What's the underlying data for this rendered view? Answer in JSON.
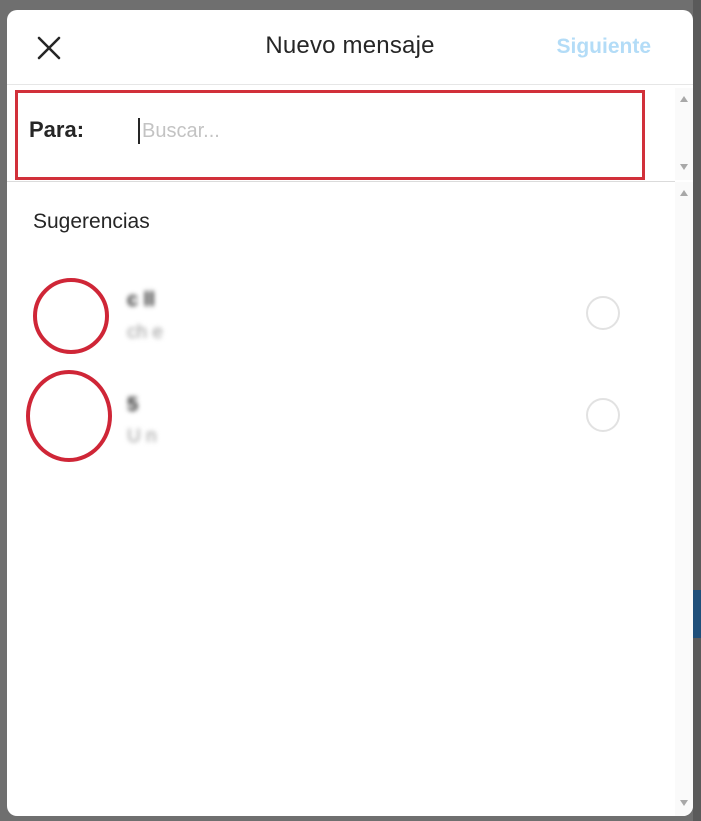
{
  "header": {
    "title": "Nuevo mensaje",
    "next_label": "Siguiente",
    "close_icon": "close-icon"
  },
  "to_field": {
    "label": "Para:",
    "placeholder": "Buscar..."
  },
  "suggestions": {
    "heading": "Sugerencias",
    "items": [
      {
        "name": "c   ll",
        "subtitle": "ch  e"
      },
      {
        "name": "   5",
        "subtitle": "U        n"
      }
    ]
  },
  "colors": {
    "highlight": "#d1303a",
    "next_disabled": "#b3dcf7",
    "text": "#262626",
    "secondary_text": "#9a9a9a"
  }
}
